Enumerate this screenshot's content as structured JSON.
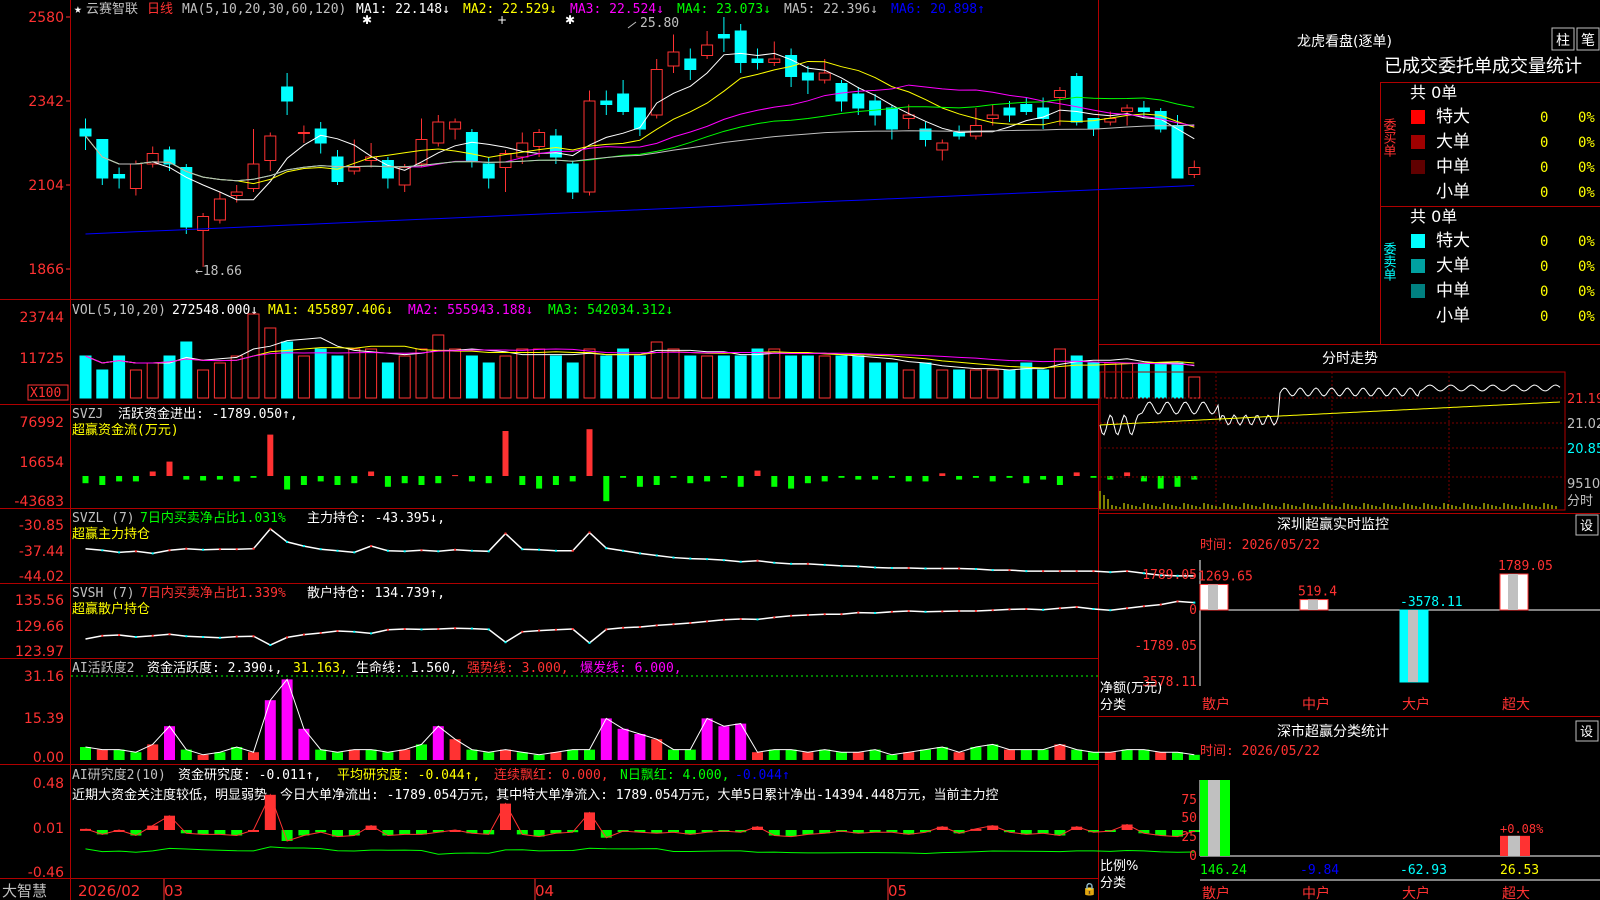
{
  "stock": {
    "star": "★",
    "name": "云赛智联",
    "period": "日线"
  },
  "colors": {
    "up": "#ff3232",
    "down": "#00ffff",
    "ma1": "#ffffff",
    "ma2": "#ffff00",
    "ma3": "#ff00ff",
    "ma4": "#00ff00",
    "ma5": "#c0c0c0",
    "ma6": "#0000ff",
    "grid": "#b00000",
    "label": "#ff3232",
    "text": "#c0c0c0"
  },
  "main": {
    "header": {
      "ma_params": "MA(5,10,20,30,60,120)",
      "ma1": "MA1: 22.148↓",
      "ma2": "MA2: 22.529↓",
      "ma3": "MA3: 22.524↓",
      "ma4": "MA4: 23.073↓",
      "ma5": "MA5: 22.396↓",
      "ma6": "MA6: 20.898↑"
    },
    "y_ticks": [
      "2580",
      "2342",
      "2104",
      "1866"
    ],
    "high_label": "25.80",
    "low_label": "←18.66"
  },
  "vol": {
    "header": {
      "params": "VOL(5,10,20)",
      "vol": "272548.000↓",
      "ma1": "MA1: 455897.406↓",
      "ma2": "MA2: 555943.188↓",
      "ma3": "MA3: 542034.312↓"
    },
    "y_ticks": [
      "23744",
      "11725"
    ],
    "unit": "X100"
  },
  "svzj": {
    "header": {
      "name": "SVZJ",
      "desc": "活跃资金进出: -1789.050↑,"
    },
    "sub": "超赢资金流(万元)",
    "y_ticks": [
      "76992",
      "16654",
      "-43683"
    ]
  },
  "svzl": {
    "header": {
      "name": "SVZL (7)",
      "desc": "7日内买卖净占比1.031%",
      "hold": "主力持仓: -43.395↓,"
    },
    "sub": "超赢主力持仓",
    "y_ticks": [
      "-30.85",
      "-37.44",
      "-44.02"
    ]
  },
  "svsh": {
    "header": {
      "name": "SVSH (7)",
      "desc": "7日内买卖净占比1.339%",
      "hold": "散户持仓: 134.739↑,"
    },
    "sub": "超赢散户持仓",
    "y_ticks": [
      "135.56",
      "129.66",
      "123.97"
    ]
  },
  "ai2": {
    "header": {
      "name": "AI活跃度2",
      "a": "资金活跃度: 2.390↓,",
      "b": "31.163,",
      "c": "生命线: 1.560,",
      "d": "强势线: 3.000,",
      "e": "爆发线: 6.000,"
    },
    "y_ticks": [
      "31.16",
      "15.39",
      "0.00"
    ]
  },
  "ai_r": {
    "header": {
      "name": "AI研究度2(10)",
      "a": "资金研究度: -0.011↑,",
      "b": "平均研究度: -0.044↑,",
      "c": "连续飘红: 0.000,",
      "d": "N日飘红: 4.000,",
      "e": "-0.044↑"
    },
    "comment": "近期大资金关注度较低，明显弱势，今日大单净流出: -1789.054万元，其中特大单净流入: 1789.054万元，大单5日累计净出-14394.448万元，当前主力控",
    "y_ticks": [
      "0.48",
      "0.01",
      "-0.46"
    ]
  },
  "xaxis": {
    "brand": "大智慧",
    "labels": [
      "2026/02",
      "03",
      "04",
      "05"
    ]
  },
  "dragon": {
    "title": "龙虎看盘(逐单)",
    "btn1": "柱",
    "btn2": "笔",
    "tabs": "已成交委托单成交量统计",
    "buy": {
      "side": "委买单",
      "total": "共 0单",
      "rows": [
        {
          "name": "特大",
          "val": "0",
          "pct": "0%",
          "color": "#ff0000"
        },
        {
          "name": "大单",
          "val": "0",
          "pct": "0%",
          "color": "#a00000"
        },
        {
          "name": "中单",
          "val": "0",
          "pct": "0%",
          "color": "#600000"
        },
        {
          "name": "小单",
          "val": "0",
          "pct": "0%",
          "color": "#000000"
        }
      ]
    },
    "sell": {
      "side": "委卖单",
      "total": "共 0单",
      "rows": [
        {
          "name": "特大",
          "val": "0",
          "pct": "0%",
          "color": "#00ffff"
        },
        {
          "name": "大单",
          "val": "0",
          "pct": "0%",
          "color": "#00a0a0"
        },
        {
          "name": "中单",
          "val": "0",
          "pct": "0%",
          "color": "#008080"
        },
        {
          "name": "小单",
          "val": "0",
          "pct": "0%",
          "color": "#000000"
        }
      ]
    }
  },
  "intraday": {
    "title": "分时走势",
    "y_ticks": [
      "21.19",
      "21.02",
      "20.85"
    ],
    "vol_label": "9510",
    "vol_unit": "分时"
  },
  "sz_monitor": {
    "title": "深圳超赢实时监控",
    "settings": "设",
    "time": "时间: 2026/05/22",
    "y_ticks": [
      "1789.05",
      "0",
      "-1789.05",
      "-3578.11"
    ],
    "axis_label1": "净额(万元)",
    "axis_label2": "分类",
    "categories": [
      "散户",
      "中户",
      "大户",
      "超大"
    ],
    "values": [
      1269.65,
      519.4,
      -3578.11,
      1789.05
    ],
    "value_labels": [
      "1269.65",
      "519.4",
      "-3578.11",
      "1789.05"
    ]
  },
  "sz_class": {
    "title": "深市超赢分类统计",
    "settings": "设",
    "time": "时间: 2026/05/22",
    "y_ticks": [
      "75",
      "50",
      "25",
      "0"
    ],
    "axis_label1": "比例%",
    "axis_label2": "分类",
    "categories": [
      "散户",
      "中户",
      "大户",
      "超大"
    ],
    "values": [
      146.24,
      -9.84,
      -62.93,
      26.53
    ],
    "value_labels": [
      "146.24",
      "-9.84",
      "-62.93",
      "26.53"
    ],
    "extra_label": "+0.08%"
  },
  "chart_data": [
    {
      "type": "candlestick",
      "title": "云赛智联 日线",
      "ylim": [
        18.0,
        26.0
      ],
      "candles": [
        [
          22.6,
          22.4,
          22.9,
          22.0
        ],
        [
          22.3,
          21.2,
          22.3,
          21.0
        ],
        [
          21.3,
          21.2,
          21.5,
          20.9
        ],
        [
          20.9,
          21.6,
          21.7,
          20.7
        ],
        [
          21.6,
          21.9,
          22.1,
          21.5
        ],
        [
          22.0,
          21.6,
          22.1,
          21.4
        ],
        [
          21.5,
          19.8,
          21.6,
          19.6
        ],
        [
          19.7,
          20.1,
          20.2,
          18.66
        ],
        [
          20.0,
          20.6,
          20.8,
          19.9
        ],
        [
          20.7,
          20.8,
          21.0,
          20.5
        ],
        [
          20.9,
          21.6,
          22.6,
          20.8
        ],
        [
          21.7,
          22.4,
          22.5,
          21.4
        ],
        [
          23.8,
          23.4,
          24.2,
          23.0
        ],
        [
          22.5,
          22.5,
          22.7,
          22.2
        ],
        [
          22.6,
          22.2,
          22.8,
          21.9
        ],
        [
          21.8,
          21.1,
          22.0,
          21.0
        ],
        [
          21.4,
          21.5,
          22.3,
          21.3
        ],
        [
          21.7,
          21.8,
          22.2,
          21.5
        ],
        [
          21.7,
          21.2,
          21.8,
          20.9
        ],
        [
          21.0,
          21.5,
          21.6,
          20.8
        ],
        [
          21.6,
          22.3,
          22.9,
          21.5
        ],
        [
          22.2,
          22.8,
          23.0,
          22.1
        ],
        [
          22.6,
          22.8,
          22.9,
          22.3
        ],
        [
          22.5,
          21.7,
          22.6,
          21.5
        ],
        [
          21.6,
          21.2,
          21.8,
          20.9
        ],
        [
          21.5,
          21.9,
          22.0,
          20.8
        ],
        [
          21.8,
          22.2,
          22.5,
          21.6
        ],
        [
          22.1,
          22.5,
          22.6,
          21.8
        ],
        [
          22.4,
          21.8,
          22.6,
          21.6
        ],
        [
          21.6,
          20.8,
          21.7,
          20.6
        ],
        [
          20.8,
          23.4,
          23.7,
          20.7
        ],
        [
          23.4,
          23.3,
          23.7,
          23.0
        ],
        [
          23.6,
          23.1,
          24.0,
          23.0
        ],
        [
          23.2,
          22.6,
          23.2,
          22.4
        ],
        [
          23.0,
          24.3,
          24.6,
          22.9
        ],
        [
          24.4,
          24.8,
          25.3,
          24.2
        ],
        [
          24.6,
          24.3,
          24.9,
          24.0
        ],
        [
          24.7,
          25.0,
          25.4,
          24.6
        ],
        [
          25.3,
          25.2,
          25.8,
          24.8
        ],
        [
          25.4,
          24.5,
          25.6,
          24.2
        ],
        [
          24.6,
          24.5,
          24.9,
          24.3
        ],
        [
          24.5,
          24.6,
          25.1,
          24.4
        ],
        [
          24.7,
          24.1,
          24.9,
          23.8
        ],
        [
          24.2,
          24.0,
          24.4,
          23.6
        ],
        [
          24.0,
          24.2,
          24.6,
          23.9
        ],
        [
          23.9,
          23.4,
          24.0,
          23.1
        ],
        [
          23.6,
          23.2,
          23.8,
          23.0
        ],
        [
          23.4,
          23.0,
          23.6,
          22.7
        ],
        [
          23.2,
          22.6,
          23.3,
          22.3
        ],
        [
          22.9,
          23.0,
          23.3,
          22.6
        ],
        [
          22.6,
          22.3,
          22.8,
          22.1
        ],
        [
          22.0,
          22.2,
          22.3,
          21.7
        ],
        [
          22.5,
          22.4,
          22.7,
          22.3
        ],
        [
          22.4,
          22.7,
          23.2,
          22.3
        ],
        [
          22.9,
          23.0,
          23.3,
          22.7
        ],
        [
          23.2,
          23.0,
          23.4,
          22.8
        ],
        [
          23.3,
          23.1,
          23.5,
          23.0
        ],
        [
          23.2,
          22.9,
          23.5,
          22.6
        ],
        [
          23.5,
          23.7,
          23.8,
          22.7
        ],
        [
          24.1,
          22.8,
          24.2,
          22.7
        ],
        [
          22.9,
          22.6,
          22.9,
          22.4
        ],
        [
          22.8,
          22.9,
          23.1,
          22.7
        ],
        [
          23.1,
          23.2,
          23.3,
          22.7
        ],
        [
          23.2,
          23.1,
          23.4,
          22.9
        ],
        [
          23.1,
          22.6,
          23.2,
          22.5
        ],
        [
          22.7,
          21.2,
          23.0,
          21.2
        ],
        [
          21.3,
          21.5,
          21.7,
          21.2
        ]
      ]
    },
    {
      "type": "bar",
      "title": "VOL",
      "values": [
        3,
        2,
        3,
        2,
        2.5,
        3,
        4,
        2,
        2.5,
        3,
        6,
        5,
        4,
        3,
        3.5,
        3,
        3.5,
        3.5,
        2.5,
        3,
        3.5,
        4.5,
        3.5,
        3,
        2.5,
        3,
        3.5,
        3.5,
        3,
        2.5,
        3.5,
        3,
        3.5,
        3,
        4,
        3.5,
        3,
        3,
        3,
        3,
        3.5,
        3.5,
        3,
        3,
        3,
        3,
        3,
        2.5,
        2.5,
        2,
        2.5,
        2,
        2,
        2,
        2,
        2,
        2.5,
        2,
        3.5,
        3,
        2.5,
        2.5,
        2.5,
        2.5,
        2.5,
        2.5,
        1.5
      ]
    },
    {
      "type": "bar",
      "title": "SVZJ",
      "values": [
        -8,
        -10,
        -6,
        -6,
        5,
        16,
        -4,
        -5,
        -4,
        -6,
        -2,
        46,
        -15,
        -10,
        -6,
        -10,
        -8,
        5,
        -12,
        -8,
        -10,
        -8,
        1,
        -6,
        -8,
        50,
        -10,
        -14,
        -10,
        -6,
        52,
        -28,
        -2,
        -12,
        -10,
        -2,
        -8,
        -6,
        -2,
        -12,
        6,
        -12,
        -14,
        -8,
        -6,
        -2,
        -4,
        -4,
        -2,
        -6,
        -6,
        3,
        -4,
        -2,
        -6,
        -2,
        -8,
        -4,
        -10,
        4,
        -2,
        -4,
        4,
        -6,
        -14,
        -12,
        -4
      ]
    },
    {
      "type": "line",
      "title": "SVZL",
      "values": [
        -38.5,
        -38.8,
        -39.2,
        -39.0,
        -39.4,
        -38.8,
        -38.5,
        -38.7,
        -38.6,
        -38.6,
        -38.5,
        -34.7,
        -37.2,
        -38.0,
        -38.6,
        -38.9,
        -39.2,
        -38.0,
        -38.9,
        -39.0,
        -38.8,
        -39.0,
        -38.7,
        -38.9,
        -39.0,
        -35.6,
        -38.6,
        -38.7,
        -38.9,
        -38.9,
        -35.4,
        -38.4,
        -38.9,
        -39.4,
        -39.8,
        -40.2,
        -40.4,
        -40.5,
        -40.7,
        -41.0,
        -40.8,
        -41.2,
        -41.4,
        -41.4,
        -41.6,
        -41.8,
        -41.9,
        -42.1,
        -42.2,
        -42.2,
        -42.3,
        -42.3,
        -42.3,
        -42.4,
        -42.6,
        -42.6,
        -42.8,
        -42.8,
        -42.8,
        -42.8,
        -42.8,
        -43.0,
        -42.8,
        -43.2,
        -43.6,
        -43.7,
        -43.7
      ]
    },
    {
      "type": "line",
      "title": "SVSH",
      "values": [
        126.0,
        126.8,
        127.0,
        126.5,
        126.8,
        127.2,
        126.7,
        126.5,
        126.3,
        126.6,
        126.7,
        124.5,
        126.4,
        127.1,
        127.5,
        128.0,
        127.8,
        127.4,
        128.3,
        128.5,
        128.4,
        128.5,
        128.7,
        128.6,
        128.4,
        125.2,
        127.8,
        128.1,
        128.3,
        128.5,
        125.0,
        128.4,
        128.8,
        129.0,
        129.4,
        129.7,
        130.0,
        130.4,
        130.8,
        131.0,
        130.9,
        131.4,
        131.8,
        132.0,
        132.2,
        132.2,
        132.6,
        132.5,
        132.8,
        133.0,
        132.8,
        132.9,
        133.0,
        133.0,
        133.2,
        133.4,
        133.5,
        133.3,
        133.7,
        134.0,
        133.5,
        133.2,
        133.7,
        134.2,
        134.6,
        135.4,
        135.1
      ]
    },
    {
      "type": "bar",
      "title": "AI活跃度2",
      "values": [
        5,
        4,
        4,
        3,
        6,
        13,
        4,
        2,
        3,
        5,
        3,
        23,
        31,
        12,
        4,
        3,
        4,
        4,
        3,
        4,
        6,
        13,
        8,
        4,
        3,
        4,
        3,
        2,
        3,
        4,
        4,
        16,
        12,
        10,
        8,
        4,
        4,
        16,
        13,
        14,
        3,
        4,
        4,
        3,
        4,
        3,
        3,
        4,
        2,
        3,
        4,
        5,
        3,
        5,
        6,
        4,
        4,
        4,
        6,
        4,
        3,
        3,
        4,
        4,
        3,
        3,
        2
      ]
    },
    {
      "type": "bar",
      "title": "AI研究度2",
      "values": [
        0.01,
        -0.04,
        0,
        -0.05,
        0.04,
        0.13,
        -0.03,
        -0.04,
        -0.04,
        -0.05,
        0,
        0.32,
        -0.1,
        -0.05,
        -0.02,
        -0.06,
        -0.05,
        0.04,
        -0.05,
        -0.04,
        -0.04,
        -0.02,
        0,
        -0.03,
        -0.04,
        0.24,
        -0.04,
        -0.06,
        -0.03,
        -0.02,
        0.16,
        -0.07,
        -0.01,
        -0.02,
        -0.03,
        -0.02,
        -0.04,
        -0.02,
        -0.01,
        -0.02,
        0.03,
        -0.05,
        -0.06,
        -0.04,
        -0.03,
        -0.01,
        -0.03,
        -0.02,
        -0.02,
        -0.04,
        -0.02,
        0.03,
        -0.03,
        0.01,
        0.04,
        -0.02,
        -0.04,
        -0.03,
        -0.05,
        0.03,
        -0.02,
        -0.01,
        0.05,
        -0.03,
        -0.05,
        -0.06,
        -0.01
      ]
    }
  ]
}
